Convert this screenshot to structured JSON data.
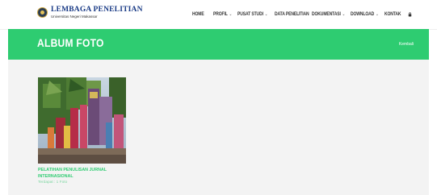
{
  "header": {
    "logo_title": "LEMBAGA PENELITIAN",
    "logo_subtitle": "Universitas Negeri Makassar",
    "nav": [
      {
        "label": "HOME",
        "dropdown": false
      },
      {
        "label": "PROFIL",
        "dropdown": true
      },
      {
        "label": "PUSAT STUDI",
        "dropdown": true
      },
      {
        "label": "DATA PENELITIAN",
        "dropdown": false
      },
      {
        "label": "DOKUMENTASI",
        "dropdown": true
      },
      {
        "label": "DOWNLOAD",
        "dropdown": true
      },
      {
        "label": "KONTAK",
        "dropdown": false
      }
    ],
    "lock_icon": "lock-icon"
  },
  "banner": {
    "title": "ALBUM FOTO",
    "back_label": "Kembali",
    "color": "#2ecc71"
  },
  "albums": [
    {
      "title": "PELATIHAN PENULISAN JURNAL INTERNASIONAL",
      "count_label": "Terdapat : 1 Foto"
    }
  ],
  "colors": {
    "accent": "#2ecc71",
    "content_bg": "#f3f3f3",
    "logo_blue": "#1a3b86"
  }
}
